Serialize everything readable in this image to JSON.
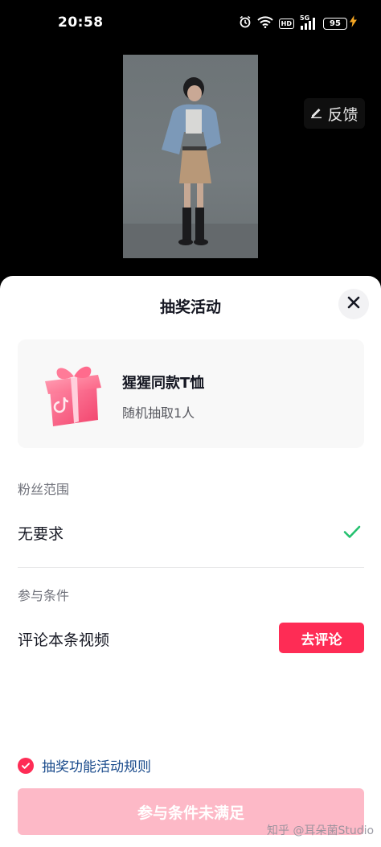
{
  "status_bar": {
    "time": "20:58",
    "network": "5G",
    "hd": "HD",
    "battery": "95"
  },
  "video": {
    "feedback_label": "反馈"
  },
  "sheet": {
    "title": "抽奖活动",
    "prize": {
      "name": "猩猩同款T恤",
      "description": "随机抽取1人"
    },
    "fan_range": {
      "label": "粉丝范围",
      "value": "无要求"
    },
    "conditions": {
      "label": "参与条件",
      "item": "评论本条视频",
      "action_label": "去评论"
    },
    "rules_label": "抽奖功能活动规则",
    "submit_label": "参与条件未满足"
  },
  "watermark": "知乎 @耳朵菌Studio",
  "colors": {
    "accent": "#fe2c55",
    "accent_disabled": "#fdb9c7",
    "success": "#25c16f",
    "link": "#1a4b8c"
  }
}
